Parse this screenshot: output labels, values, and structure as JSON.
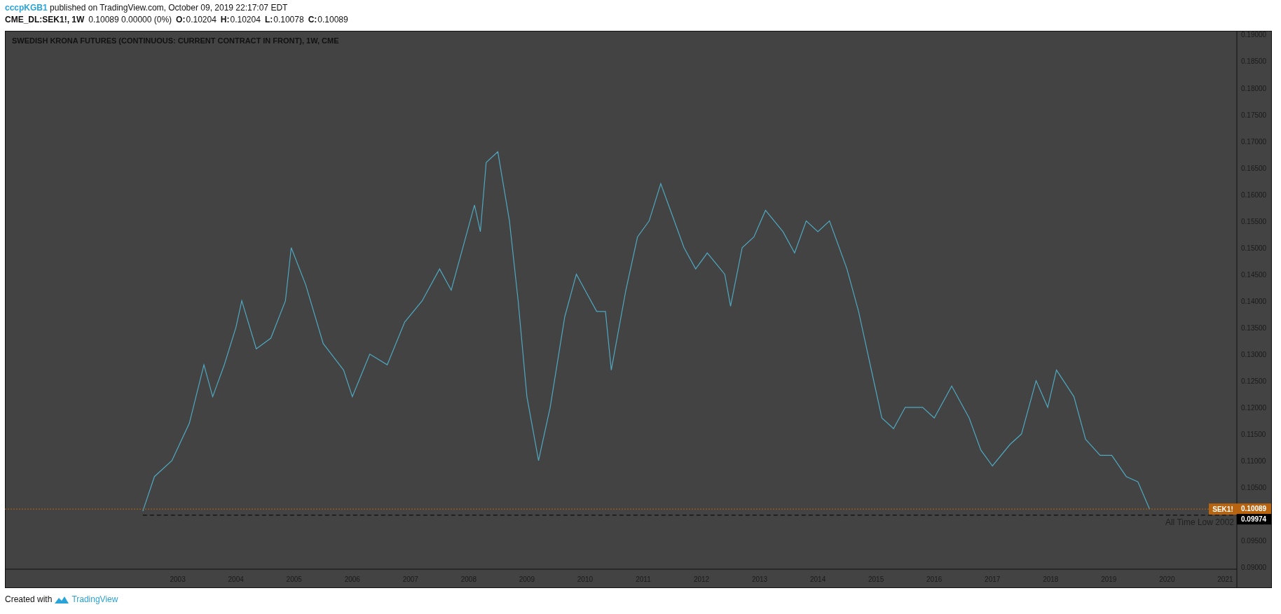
{
  "header": {
    "author": "cccpKGB1",
    "published": "published on TradingView.com, October 09, 2019 22:17:07 EDT",
    "symbol": "CME_DL:SEK1!, 1W",
    "change": "0.10089 0.00000 (0%)",
    "ohlc": [
      {
        "label": "O:",
        "value": "0.10204"
      },
      {
        "label": "H:",
        "value": "0.10204"
      },
      {
        "label": "L:",
        "value": "0.10078"
      },
      {
        "label": "C:",
        "value": "0.10089"
      }
    ]
  },
  "chart": {
    "chart_data": {
      "type": "line",
      "title": "SWEDISH KRONA FUTURES (CONTINUOUS: CURRENT CONTRACT IN FRONT), 1W, CME",
      "x": [
        2002.4,
        2002.6,
        2002.9,
        2003.2,
        2003.45,
        2003.6,
        2003.8,
        2004.0,
        2004.1,
        2004.35,
        2004.6,
        2004.85,
        2004.95,
        2005.2,
        2005.5,
        2005.85,
        2006.0,
        2006.3,
        2006.6,
        2006.9,
        2007.2,
        2007.5,
        2007.7,
        2007.9,
        2008.1,
        2008.2,
        2008.3,
        2008.5,
        2008.7,
        2008.85,
        2009.0,
        2009.2,
        2009.4,
        2009.65,
        2009.85,
        2010.0,
        2010.2,
        2010.35,
        2010.45,
        2010.7,
        2010.9,
        2011.1,
        2011.3,
        2011.5,
        2011.7,
        2011.9,
        2012.1,
        2012.4,
        2012.5,
        2012.7,
        2012.9,
        2013.1,
        2013.4,
        2013.6,
        2013.8,
        2014.0,
        2014.2,
        2014.5,
        2014.7,
        2014.9,
        2015.1,
        2015.3,
        2015.5,
        2015.8,
        2016.0,
        2016.3,
        2016.6,
        2016.8,
        2017.0,
        2017.3,
        2017.5,
        2017.75,
        2017.95,
        2018.1,
        2018.4,
        2018.6,
        2018.85,
        2019.05,
        2019.3,
        2019.5,
        2019.7
      ],
      "series": [
        {
          "color": "#4fa8c0",
          "values": [
            0.1005,
            0.107,
            0.11,
            0.117,
            0.128,
            0.122,
            0.128,
            0.135,
            0.14,
            0.131,
            0.133,
            0.14,
            0.15,
            0.143,
            0.132,
            0.127,
            0.122,
            0.13,
            0.128,
            0.136,
            0.14,
            0.146,
            0.142,
            0.15,
            0.158,
            0.153,
            0.166,
            0.168,
            0.155,
            0.14,
            0.122,
            0.11,
            0.12,
            0.137,
            0.145,
            0.142,
            0.138,
            0.138,
            0.127,
            0.142,
            0.152,
            0.155,
            0.162,
            0.156,
            0.15,
            0.146,
            0.149,
            0.145,
            0.139,
            0.15,
            0.152,
            0.157,
            0.153,
            0.149,
            0.155,
            0.153,
            0.155,
            0.146,
            0.138,
            0.128,
            0.118,
            0.116,
            0.12,
            0.12,
            0.118,
            0.124,
            0.118,
            0.112,
            0.109,
            0.113,
            0.115,
            0.125,
            0.12,
            0.127,
            0.122,
            0.114,
            0.111,
            0.111,
            0.107,
            0.106,
            0.1009
          ]
        }
      ],
      "xlim": [
        2000.03,
        2021.2
      ],
      "ylim": [
        0.0896,
        0.19072
      ],
      "xticks": [
        2003,
        2004,
        2005,
        2006,
        2007,
        2008,
        2009,
        2010,
        2011,
        2012,
        2013,
        2014,
        2015,
        2016,
        2017,
        2018,
        2019,
        2020,
        2021
      ],
      "yticks": [
        {
          "value": 0.09,
          "label": "0.09000"
        },
        {
          "value": 0.095,
          "label": "0.09500"
        },
        {
          "value": 0.105,
          "label": "0.10500"
        },
        {
          "value": 0.11,
          "label": "0.11000"
        },
        {
          "value": 0.115,
          "label": "0.11500"
        },
        {
          "value": 0.12,
          "label": "0.12000"
        },
        {
          "value": 0.125,
          "label": "0.12500"
        },
        {
          "value": 0.13,
          "label": "0.13000"
        },
        {
          "value": 0.135,
          "label": "0.13500"
        },
        {
          "value": 0.14,
          "label": "0.14000"
        },
        {
          "value": 0.145,
          "label": "0.14500"
        },
        {
          "value": 0.15,
          "label": "0.15000"
        },
        {
          "value": 0.155,
          "label": "0.15500"
        },
        {
          "value": 0.16,
          "label": "0.16000"
        },
        {
          "value": 0.165,
          "label": "0.16500"
        },
        {
          "value": 0.17,
          "label": "0.17000"
        },
        {
          "value": 0.175,
          "label": "0.17500"
        },
        {
          "value": 0.18,
          "label": "0.18000"
        },
        {
          "value": 0.185,
          "label": "0.18500"
        },
        {
          "value": 0.19,
          "label": "0.19000"
        }
      ],
      "ref_lines": [
        {
          "axis": "y",
          "value": 0.10089,
          "label": "SEK1!",
          "color": "#b8640f"
        },
        {
          "axis": "y",
          "value": 0.09974,
          "label": "All Time Low 2002",
          "color": "#000000"
        }
      ]
    },
    "axis_tags": [
      "0.10089",
      "0.09974"
    ]
  },
  "footer": {
    "text": "Created with",
    "brand": "TradingView"
  }
}
